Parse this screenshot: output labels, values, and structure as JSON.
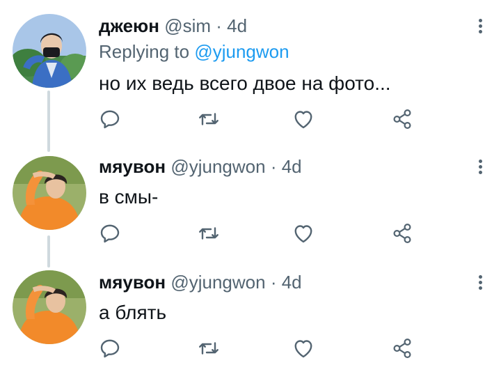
{
  "tweets": [
    {
      "author_name": "джеюн",
      "handle": "@sim",
      "separator": "·",
      "time": "4d",
      "replying_prefix": "Replying to",
      "replying_mention": "@yjungwon",
      "text": "но их ведь всего двое на фото...",
      "avatar": "blue-jacket-portrait"
    },
    {
      "author_name": "мяувон",
      "handle": "@yjungwon",
      "separator": "·",
      "time": "4d",
      "text": "в смы-",
      "avatar": "orange-sweater-portrait"
    },
    {
      "author_name": "мяувон",
      "handle": "@yjungwon",
      "separator": "·",
      "time": "4d",
      "text": "а блять",
      "avatar": "orange-sweater-portrait"
    }
  ],
  "icons": {
    "reply": "reply-icon",
    "retweet": "retweet-icon",
    "like": "heart-icon",
    "share": "share-icon",
    "more": "more-vertical-icon"
  },
  "colors": {
    "text_primary": "#0f1419",
    "text_secondary": "#536471",
    "link": "#1d9bf0",
    "thread_line": "#cfd9de"
  }
}
